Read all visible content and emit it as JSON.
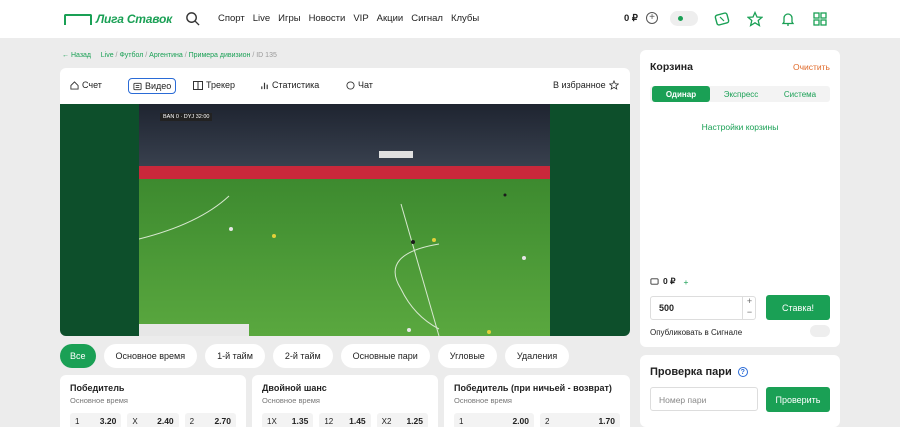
{
  "header": {
    "logo_text": "Лига Ставок",
    "nav": [
      "Спорт",
      "Live",
      "Игры",
      "Новости",
      "VIP",
      "Акции",
      "Сигнал",
      "Клубы"
    ],
    "balance": "0 ₽"
  },
  "breadcrumb": {
    "back": "← Назад",
    "path": [
      "Live",
      "Футбол",
      "Аргентина",
      "Примера дивизион"
    ],
    "id": "ID 135"
  },
  "event_tabs": {
    "score": "Счет",
    "video": "Видео",
    "tracker": "Трекер",
    "stats": "Статистика",
    "chat": "Чат",
    "favorite": "В избранное"
  },
  "video": {
    "team_home": "BAN",
    "team_away": "DYJ",
    "clock": "32:00"
  },
  "market_filters": [
    "Все",
    "Основное время",
    "1-й тайм",
    "2-й тайм",
    "Основные пари",
    "Угловые",
    "Удаления"
  ],
  "markets": [
    {
      "title": "Победитель",
      "subtitle": "Основное время",
      "odds": [
        {
          "label": "1",
          "value": "3.20"
        },
        {
          "label": "X",
          "value": "2.40"
        },
        {
          "label": "2",
          "value": "2.70"
        }
      ]
    },
    {
      "title": "Двойной шанс",
      "subtitle": "Основное время",
      "odds": [
        {
          "label": "1X",
          "value": "1.35"
        },
        {
          "label": "12",
          "value": "1.45"
        },
        {
          "label": "X2",
          "value": "1.25"
        }
      ]
    },
    {
      "title": "Победитель (при ничьей - возврат)",
      "subtitle": "Основное время",
      "odds": [
        {
          "label": "1",
          "value": "2.00"
        },
        {
          "label": "2",
          "value": "1.70"
        }
      ]
    }
  ],
  "cart": {
    "title": "Корзина",
    "clear": "Очистить",
    "tabs": [
      "Одинар",
      "Экспресс",
      "Система"
    ],
    "settings": "Настройки корзины",
    "balance": "0 ₽",
    "stake": "500",
    "place_bet": "Ставка!",
    "publish": "Опубликовать в Сигнале"
  },
  "bet_check": {
    "title": "Проверка пари",
    "placeholder": "Номер пари",
    "button": "Проверить"
  },
  "colors": {
    "accent": "#1aa055",
    "clear": "#e06a2a",
    "video_bg": "#0d4f2b"
  }
}
